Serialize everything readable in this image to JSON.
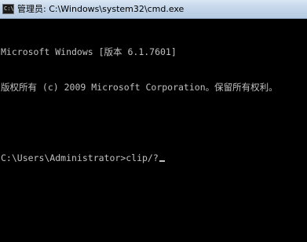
{
  "window": {
    "title": "管理员: C:\\Windows\\system32\\cmd.exe",
    "icon": "cmd-icon",
    "icon_glyph": "C:\\"
  },
  "console": {
    "lines": [
      "Microsoft Windows [版本 6.1.7601]",
      "版权所有 (c) 2009 Microsoft Corporation。保留所有权利。",
      "",
      "C:\\Users\\Administrator>clip/?"
    ]
  },
  "colors": {
    "background": "#000000",
    "text": "#c0c0c0",
    "titlebar": "#c4d6ea"
  }
}
